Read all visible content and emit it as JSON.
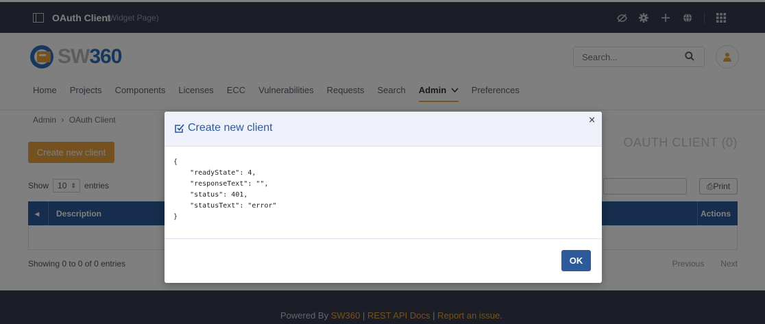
{
  "topbar": {
    "title": "OAuth Client",
    "subtitle": "(Widget Page)",
    "icons": [
      "eye-slash-icon",
      "gear-icon",
      "plus-icon",
      "globe-icon",
      "grid-icon"
    ]
  },
  "header": {
    "logo_text_prefix": "SW",
    "logo_text_suffix": "360",
    "search_placeholder": "Search...",
    "nav": [
      {
        "label": "Home"
      },
      {
        "label": "Projects"
      },
      {
        "label": "Components"
      },
      {
        "label": "Licenses"
      },
      {
        "label": "ECC"
      },
      {
        "label": "Vulnerabilities"
      },
      {
        "label": "Requests"
      },
      {
        "label": "Search"
      },
      {
        "label": "Admin"
      },
      {
        "label": "Preferences"
      }
    ]
  },
  "main": {
    "breadcrumb": {
      "parent": "Admin",
      "sep": "›",
      "current": "OAuth Client"
    },
    "create_button": "Create new client",
    "heading": "OAUTH CLIENT (0)",
    "show_label": "Show",
    "show_value": "10",
    "entries_label": "entries",
    "print_label": "Print",
    "table": {
      "columns": [
        "Description",
        "Actions"
      ]
    },
    "info": "Showing 0 to 0 of 0 entries",
    "pager": {
      "previous": "Previous",
      "next": "Next"
    }
  },
  "footer": {
    "powered_by": "Powered By",
    "link1": "SW360",
    "sep": "|",
    "link2": "REST API Docs",
    "link3": "Report an issue."
  },
  "modal": {
    "title": "Create new client",
    "close": "×",
    "body": "{\n    \"readyState\": 4,\n    \"responseText\": \"\",\n    \"status\": 401,\n    \"statusText\": \"error\"\n}",
    "ok": "OK"
  },
  "colors": {
    "topbar": "#373b4e",
    "accent": "#e8a33d",
    "primary": "#2c5a9a"
  }
}
